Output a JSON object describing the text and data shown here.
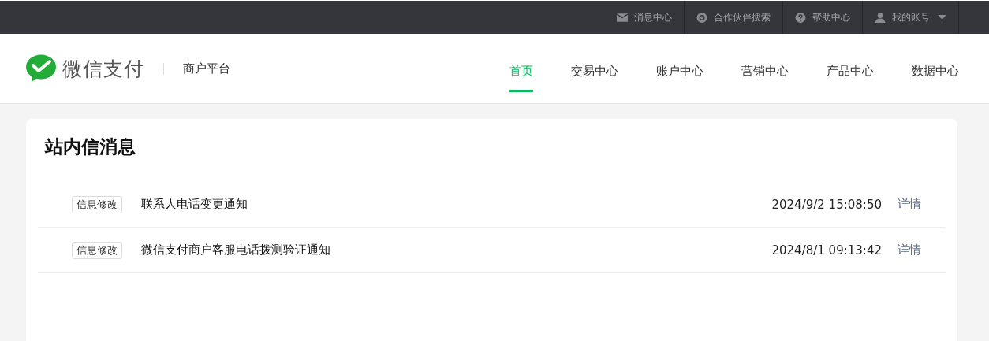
{
  "top_bar": {
    "items": [
      {
        "kind": "mail",
        "label": "消息中心",
        "dropdown": false
      },
      {
        "kind": "search",
        "label": "合作伙伴搜索",
        "dropdown": false
      },
      {
        "kind": "help",
        "label": "帮助中心",
        "dropdown": false
      },
      {
        "kind": "user",
        "label": "我的账号",
        "dropdown": true
      }
    ]
  },
  "header": {
    "brand": "微信支付",
    "platform": "商户平台",
    "nav": [
      {
        "label": "首页",
        "selected": true
      },
      {
        "label": "交易中心",
        "selected": false
      },
      {
        "label": "账户中心",
        "selected": false
      },
      {
        "label": "营销中心",
        "selected": false
      },
      {
        "label": "产品中心",
        "selected": false
      },
      {
        "label": "数据中心",
        "selected": false
      }
    ]
  },
  "card": {
    "title": "站内信消息",
    "messages": [
      {
        "tag": "信息修改",
        "title": "联系人电话变更通知",
        "time": "2024/9/2 15:08:50",
        "link": "详情"
      },
      {
        "tag": "信息修改",
        "title": "微信支付商户客服电话拨测验证通知",
        "time": "2024/8/1 09:13:42",
        "link": "详情"
      }
    ]
  }
}
